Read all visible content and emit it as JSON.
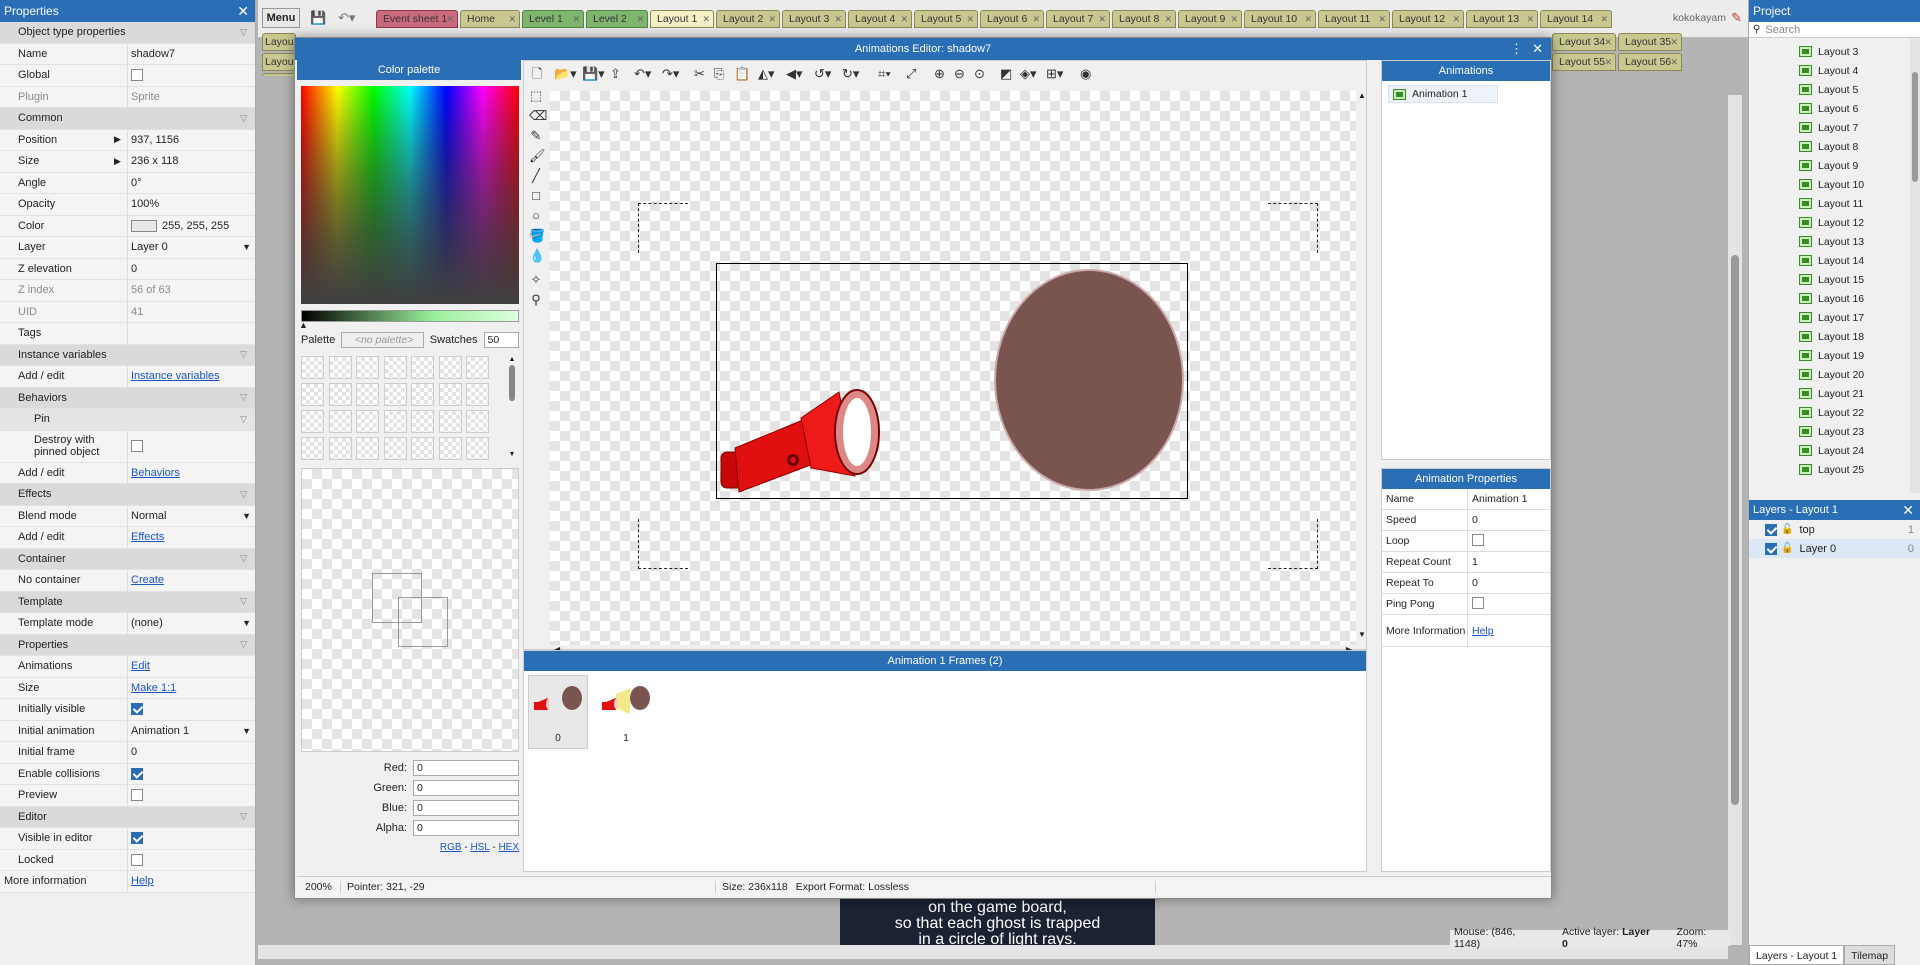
{
  "properties": {
    "title": "Properties",
    "rows": [
      {
        "type": "sec",
        "label": "Object type properties"
      },
      {
        "type": "row",
        "k": "Name",
        "v": "shadow7"
      },
      {
        "type": "check",
        "k": "Global",
        "on": false
      },
      {
        "type": "row",
        "k": "Plugin",
        "v": "Sprite",
        "gray": true
      },
      {
        "type": "sec",
        "label": "Common"
      },
      {
        "type": "exp",
        "k": "Position",
        "v": "937, 1156"
      },
      {
        "type": "exp",
        "k": "Size",
        "v": "236 x 118"
      },
      {
        "type": "row",
        "k": "Angle",
        "v": "0°"
      },
      {
        "type": "row",
        "k": "Opacity",
        "v": "100%"
      },
      {
        "type": "color",
        "k": "Color",
        "v": "255, 255, 255"
      },
      {
        "type": "select",
        "k": "Layer",
        "v": "Layer 0"
      },
      {
        "type": "row",
        "k": "Z elevation",
        "v": "0"
      },
      {
        "type": "row",
        "k": "Z index",
        "v": "56 of 63",
        "gray": true
      },
      {
        "type": "row",
        "k": "UID",
        "v": "41",
        "gray": true
      },
      {
        "type": "row",
        "k": "Tags",
        "v": ""
      },
      {
        "type": "sec",
        "label": "Instance variables"
      },
      {
        "type": "link",
        "k": "Add / edit",
        "v": "Instance variables"
      },
      {
        "type": "sec",
        "label": "Behaviors"
      },
      {
        "type": "subsec",
        "label": "Pin"
      },
      {
        "type": "subcheck",
        "k": "Destroy with pinned object",
        "on": false
      },
      {
        "type": "link",
        "k": "Add / edit",
        "v": "Behaviors"
      },
      {
        "type": "sec",
        "label": "Effects"
      },
      {
        "type": "select",
        "k": "Blend mode",
        "v": "Normal"
      },
      {
        "type": "link",
        "k": "Add / edit",
        "v": "Effects"
      },
      {
        "type": "sec",
        "label": "Container"
      },
      {
        "type": "link",
        "k": "No container",
        "v": "Create"
      },
      {
        "type": "sec",
        "label": "Template"
      },
      {
        "type": "select",
        "k": "Template mode",
        "v": "(none)"
      },
      {
        "type": "sec",
        "label": "Properties"
      },
      {
        "type": "link",
        "k": "Animations",
        "v": "Edit"
      },
      {
        "type": "link",
        "k": "Size",
        "v": "Make 1:1"
      },
      {
        "type": "check",
        "k": "Initially visible",
        "on": true
      },
      {
        "type": "select",
        "k": "Initial animation",
        "v": "Animation 1"
      },
      {
        "type": "row",
        "k": "Initial frame",
        "v": "0"
      },
      {
        "type": "check",
        "k": "Enable collisions",
        "on": true
      },
      {
        "type": "check",
        "k": "Preview",
        "on": false
      },
      {
        "type": "sec",
        "label": "Editor"
      },
      {
        "type": "check",
        "k": "Visible in editor",
        "on": true
      },
      {
        "type": "check",
        "k": "Locked",
        "on": false
      },
      {
        "type": "morelink",
        "k": "More information",
        "v": "Help"
      }
    ]
  },
  "topbar": {
    "menu_label": "Menu",
    "tabs_row1": [
      "Event sheet 1",
      "Home",
      "Level 1",
      "Level 2",
      "Layout 1",
      "Layout 2",
      "Layout 3",
      "Layout 4",
      "Layout 5",
      "Layout 6",
      "Layout 7",
      "Layout 8",
      "Layout 9",
      "Layout 10",
      "Layout 11",
      "Layout 12",
      "Layout 13",
      "Layout 14"
    ],
    "tabs_row2_right": [
      "Layout 34",
      "Layout 35"
    ],
    "tabs_row3_right": [
      "Layout 55",
      "Layout 56"
    ],
    "tabs_left_stub": [
      "Layou",
      "Layou",
      "Layou"
    ],
    "user": "kokokayam"
  },
  "project": {
    "title": "Project",
    "search_placeholder": "Search",
    "items": [
      "Layout 3",
      "Layout 4",
      "Layout 5",
      "Layout 6",
      "Layout 7",
      "Layout 8",
      "Layout 9",
      "Layout 10",
      "Layout 11",
      "Layout 12",
      "Layout 13",
      "Layout 14",
      "Layout 15",
      "Layout 16",
      "Layout 17",
      "Layout 18",
      "Layout 19",
      "Layout 20",
      "Layout 21",
      "Layout 22",
      "Layout 23",
      "Layout 24",
      "Layout 25"
    ]
  },
  "layers": {
    "title": "Layers - Layout 1",
    "items": [
      {
        "name": "top",
        "num": "1"
      },
      {
        "name": "Layer 0",
        "num": "0"
      }
    ],
    "bottom_tabs": [
      "Layers - Layout 1",
      "Tilemap"
    ]
  },
  "status": {
    "mouse": "Mouse: (846, 1148)",
    "active_layer_label": "Active layer:",
    "active_layer": "Layer 0",
    "zoom": "Zoom: 47%"
  },
  "background_text": [
    "on the game board,",
    "so that each ghost is trapped",
    "in a circle of light rays."
  ],
  "dialog": {
    "title": "Animations Editor: shadow7",
    "palette": {
      "title": "Color palette",
      "palette_label": "Palette",
      "palette_value": "<no palette>",
      "swatches_label": "Swatches",
      "swatches_value": "50",
      "red_label": "Red:",
      "red": "0",
      "green_label": "Green:",
      "green": "0",
      "blue_label": "Blue:",
      "blue": "0",
      "alpha_label": "Alpha:",
      "alpha": "0",
      "rgb": "RGB",
      "hsl": "HSL",
      "hex": "HEX"
    },
    "animations": {
      "title": "Animations",
      "items": [
        "Animation 1"
      ]
    },
    "anim_props": {
      "title": "Animation Properties",
      "rows": [
        {
          "k": "Name",
          "v": "Animation 1"
        },
        {
          "k": "Speed",
          "v": "0"
        },
        {
          "k": "Loop",
          "check": false
        },
        {
          "k": "Repeat Count",
          "v": "1"
        },
        {
          "k": "Repeat To",
          "v": "0"
        },
        {
          "k": "Ping Pong",
          "check": false
        },
        {
          "k": "More Information",
          "link": "Help"
        }
      ]
    },
    "frames": {
      "title": "Animation 1 Frames (2)",
      "items": [
        "0",
        "1"
      ]
    },
    "statusbar": {
      "zoom": "200%",
      "pointer": "Pointer: 321, -29",
      "size": "Size: 236x118",
      "export": "Export Format: Lossless"
    },
    "colors": {
      "flashlight": "#e01010",
      "blob": "#7a5550",
      "accent": "#2a6eb6"
    }
  }
}
